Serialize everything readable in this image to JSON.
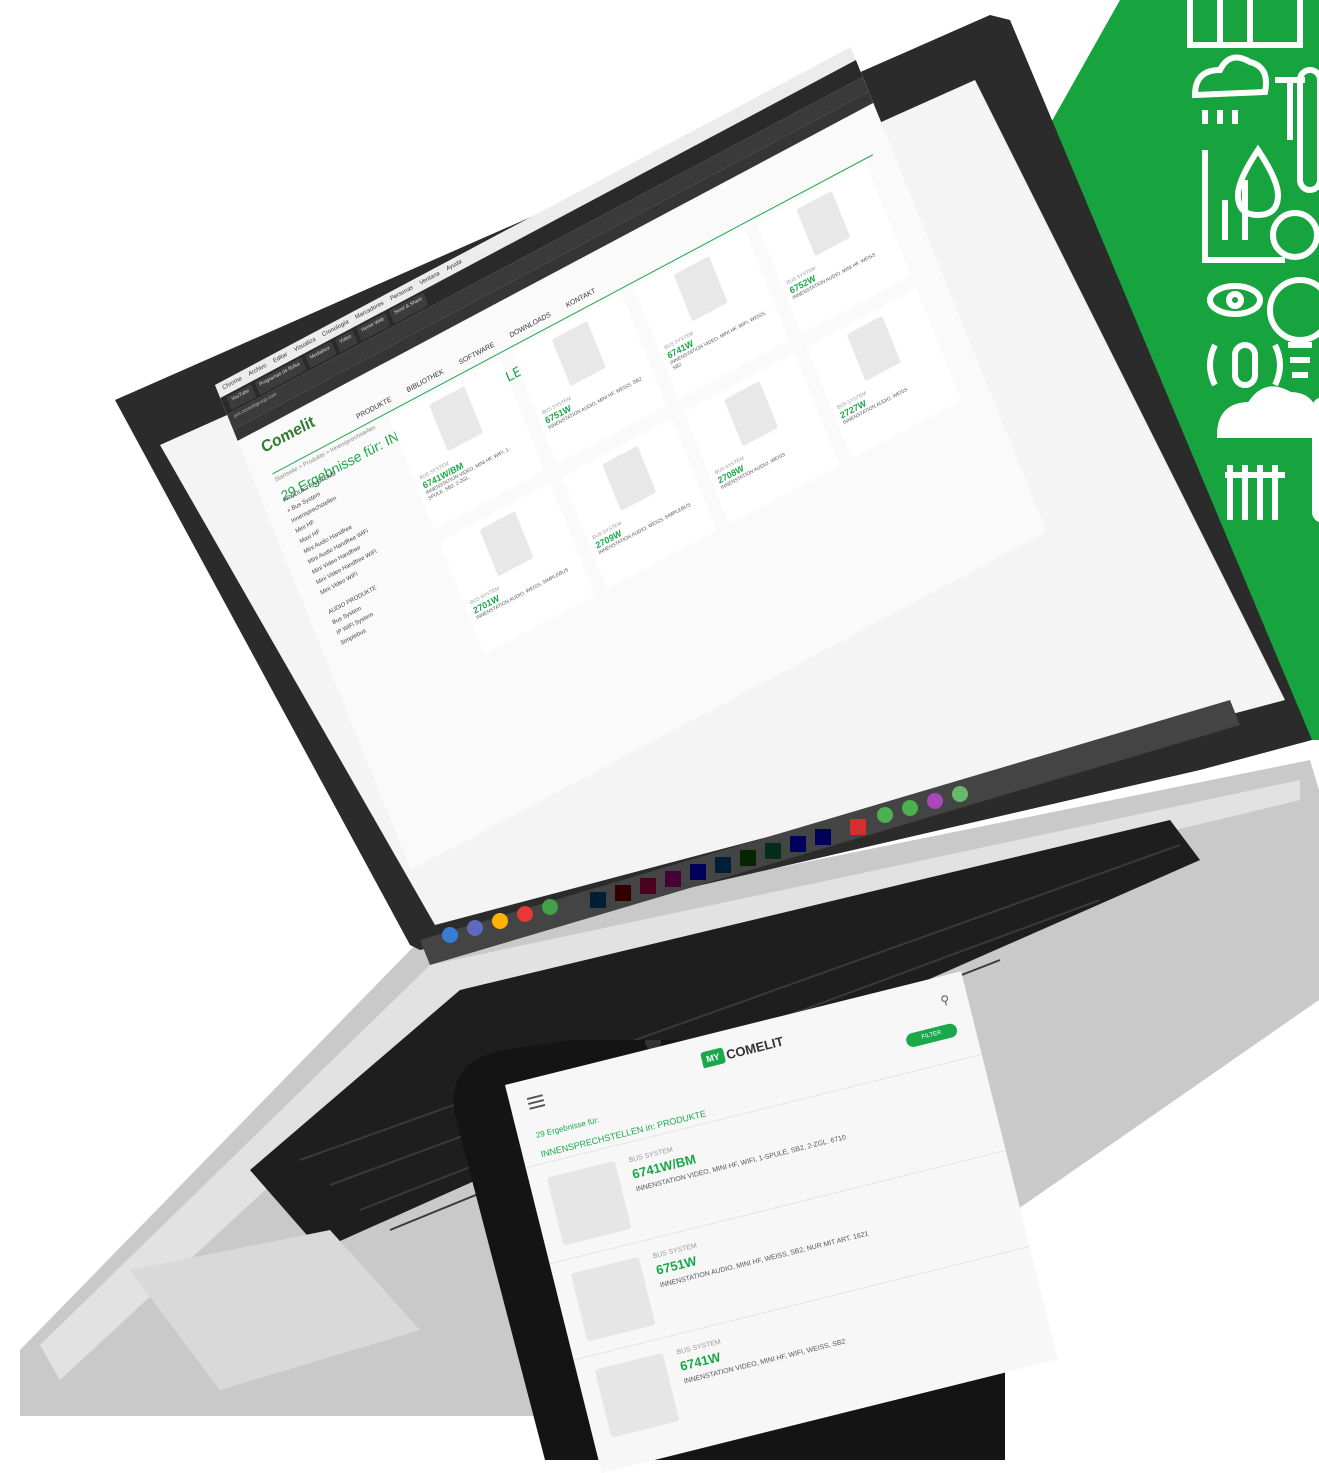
{
  "colors": {
    "brand_green": "#1aa84a",
    "hex_green": "#17a33e",
    "laptop_dark": "#2b2b2b",
    "laptop_silver": "#c9c9c9"
  },
  "laptop_screen": {
    "menubar": [
      "Chrome",
      "Archivo",
      "Editar",
      "Visualiza",
      "Cronología",
      "Marcadores",
      "Personas",
      "Ventana",
      "Ayuda"
    ],
    "tabs": [
      "YouTube",
      "Programas de Bolsa",
      "Mediabox",
      "Video",
      "Home Web",
      "Send & Share"
    ],
    "url": "pro.comelitgroup.com",
    "logo": "Comelit",
    "nav": [
      "PRODUKTE",
      "BIBLIOTHEK",
      "SOFTWARE",
      "DOWNLOADS",
      "KONTAKT"
    ],
    "breadcrumb": "Startseite > Produkte > Innensprechstellen",
    "results_title": "29 Ergebnisse für: INNENSPRECHSTELLEN in: PRODUKTE",
    "sidebar_title": "PRODUKT-SYSTEME",
    "sidebar_items": [
      "» Bus System",
      "Innensprechstellen",
      "Mini HF",
      "Maxi HF",
      "Mini Audio Handfree",
      "Mini Audio Handfree WiFi",
      "Mini Video Handfree",
      "Mini Video Handfree WiFi",
      "Mini Video WiFi"
    ],
    "sidebar_title2": "AUDIO PRODUKTE",
    "sidebar_items2": [
      "Bus System",
      "IP WiFi System",
      "Simplebus"
    ],
    "cards": [
      {
        "cat": "BUS SYSTEM",
        "code": "6741W/BM",
        "desc": "INNENSTATION VIDEO, MINI HF, WIFI, 1-SPULE, SB2, 2-ZGL."
      },
      {
        "cat": "BUS SYSTEM",
        "code": "6751W",
        "desc": "INNENSTATION AUDIO, MINI HF, WEISS, SB2"
      },
      {
        "cat": "BUS SYSTEM",
        "code": "6741W",
        "desc": "INNENSTATION VIDEO, MINI HF, WIFI, WEISS, SB2"
      },
      {
        "cat": "BUS SYSTEM",
        "code": "6752W",
        "desc": "INNENSTATION AUDIO, MINI HF, WEISS"
      },
      {
        "cat": "BUS SYSTEM",
        "code": "2701W",
        "desc": "INNENSTATION AUDIO, WEISS, SIMPLEBUS"
      },
      {
        "cat": "BUS SYSTEM",
        "code": "2709W",
        "desc": "INNENSTATION AUDIO, WEISS, SIMPLEBUS"
      },
      {
        "cat": "BUS SYSTEM",
        "code": "2708W",
        "desc": "INNENSTATION AUDIO, WEISS"
      },
      {
        "cat": "BUS SYSTEM",
        "code": "2727W",
        "desc": "INNENSTATION AUDIO, WEISS"
      }
    ]
  },
  "phone_screen": {
    "logo_my": "MY",
    "logo_text": "COMELIT",
    "results_prefix": "29 Ergebnisse für:",
    "results_query": "INNENSPRECHSTELLEN in: PRODUKTE",
    "filter_label": "FILTER",
    "items": [
      {
        "cat": "BUS SYSTEM",
        "code": "6741W/BM",
        "desc": "INNENSTATION VIDEO, MINI HF, WIFI, 1-SPULE, SB2, 2-ZGL. 6710"
      },
      {
        "cat": "BUS SYSTEM",
        "code": "6751W",
        "desc": "INNENSTATION AUDIO, MINI HF, WEISS, SB2, NUR MIT ART. 1621"
      },
      {
        "cat": "BUS SYSTEM",
        "code": "6741W",
        "desc": "INNENSTATION VIDEO, MINI HF, WIFI, WEISS, SB2"
      }
    ]
  },
  "dock_apps": [
    "Ps",
    "Ai",
    "Id",
    "Xd",
    "Ae",
    "Lr",
    "Dw",
    "Dn",
    "Pr",
    "Me"
  ]
}
